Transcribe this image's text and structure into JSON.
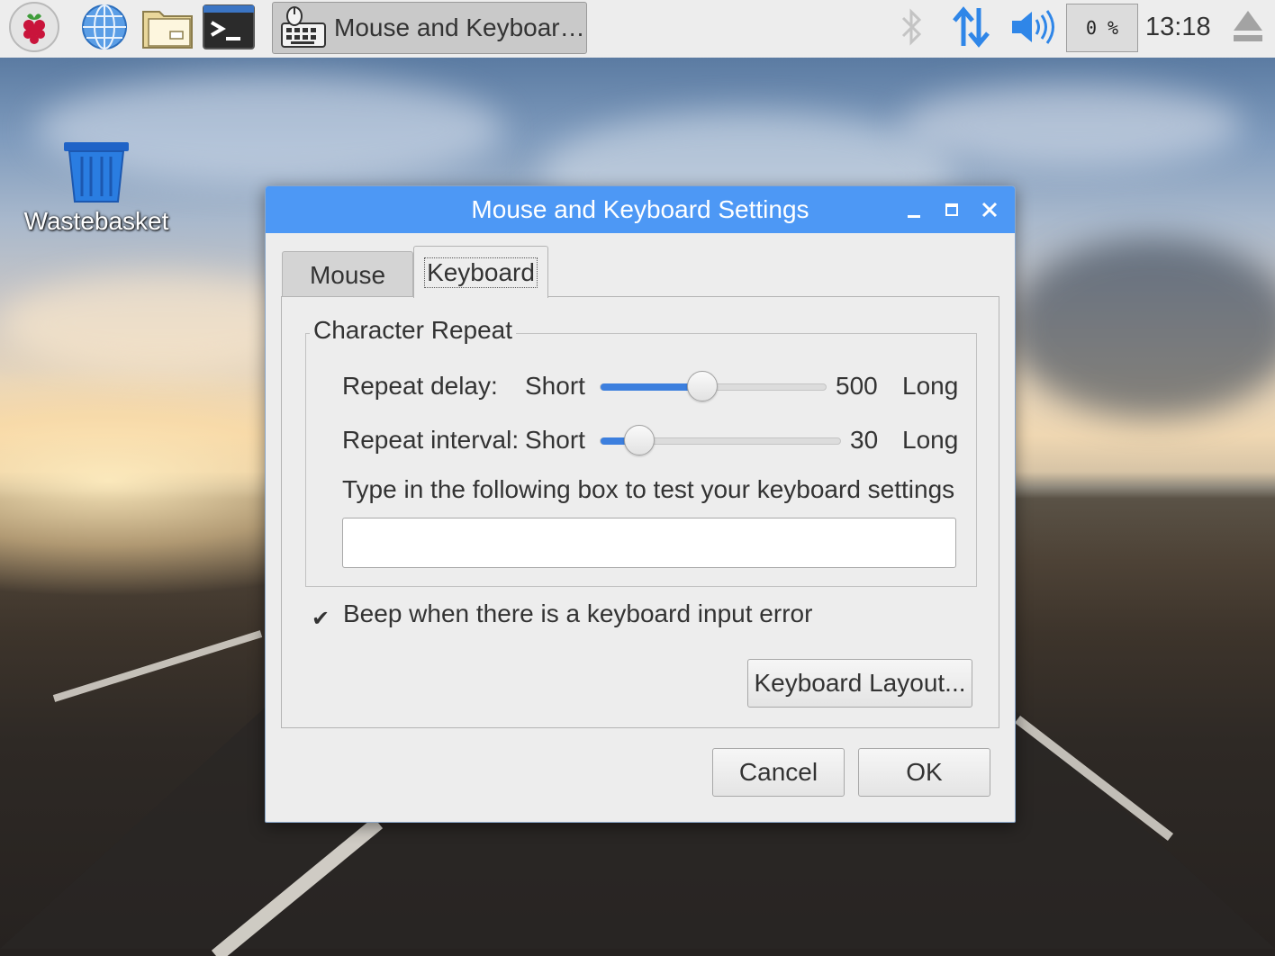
{
  "taskbar": {
    "launchers": [
      {
        "name": "raspberry-menu",
        "icon": "raspberry-icon"
      },
      {
        "name": "web-browser",
        "icon": "globe-icon"
      },
      {
        "name": "file-manager",
        "icon": "folder-icon"
      },
      {
        "name": "terminal",
        "icon": "terminal-icon"
      }
    ],
    "task_button_label": "Mouse and Keyboar…",
    "cpu_usage": "0 %",
    "clock": "13:18",
    "colors": {
      "network": "#2f86e8",
      "volume": "#2f86e8",
      "bluetooth": "#c8c8c8",
      "eject": "#9a9a9a"
    }
  },
  "desktop": {
    "icons": [
      {
        "label": "Wastebasket",
        "icon": "trash-icon"
      }
    ]
  },
  "dialog": {
    "title": "Mouse and Keyboard Settings",
    "titlebar_color": "#4d98f5",
    "window_controls": {
      "minimize": "‒",
      "maximize": "□",
      "close": "✕"
    },
    "tabs": [
      {
        "label": "Mouse",
        "active": false
      },
      {
        "label": "Keyboard",
        "active": true
      }
    ],
    "character_repeat": {
      "legend": "Character Repeat",
      "repeat_delay": {
        "label": "Repeat delay:",
        "min_label": "Short",
        "max_label": "Long",
        "value": "500",
        "fraction": 0.45
      },
      "repeat_interval": {
        "label": "Repeat interval:",
        "min_label": "Short",
        "max_label": "Long",
        "value": "30",
        "fraction": 0.16
      },
      "test_label": "Type in the following box to test your keyboard settings",
      "test_value": "",
      "test_placeholder": ""
    },
    "beep": {
      "label": "Beep when there is a keyboard input error",
      "checked": true,
      "check_glyph": "✔"
    },
    "keyboard_layout_button": "Keyboard Layout...",
    "buttons": {
      "cancel": "Cancel",
      "ok": "OK"
    },
    "accent_color": "#3c7fde"
  }
}
